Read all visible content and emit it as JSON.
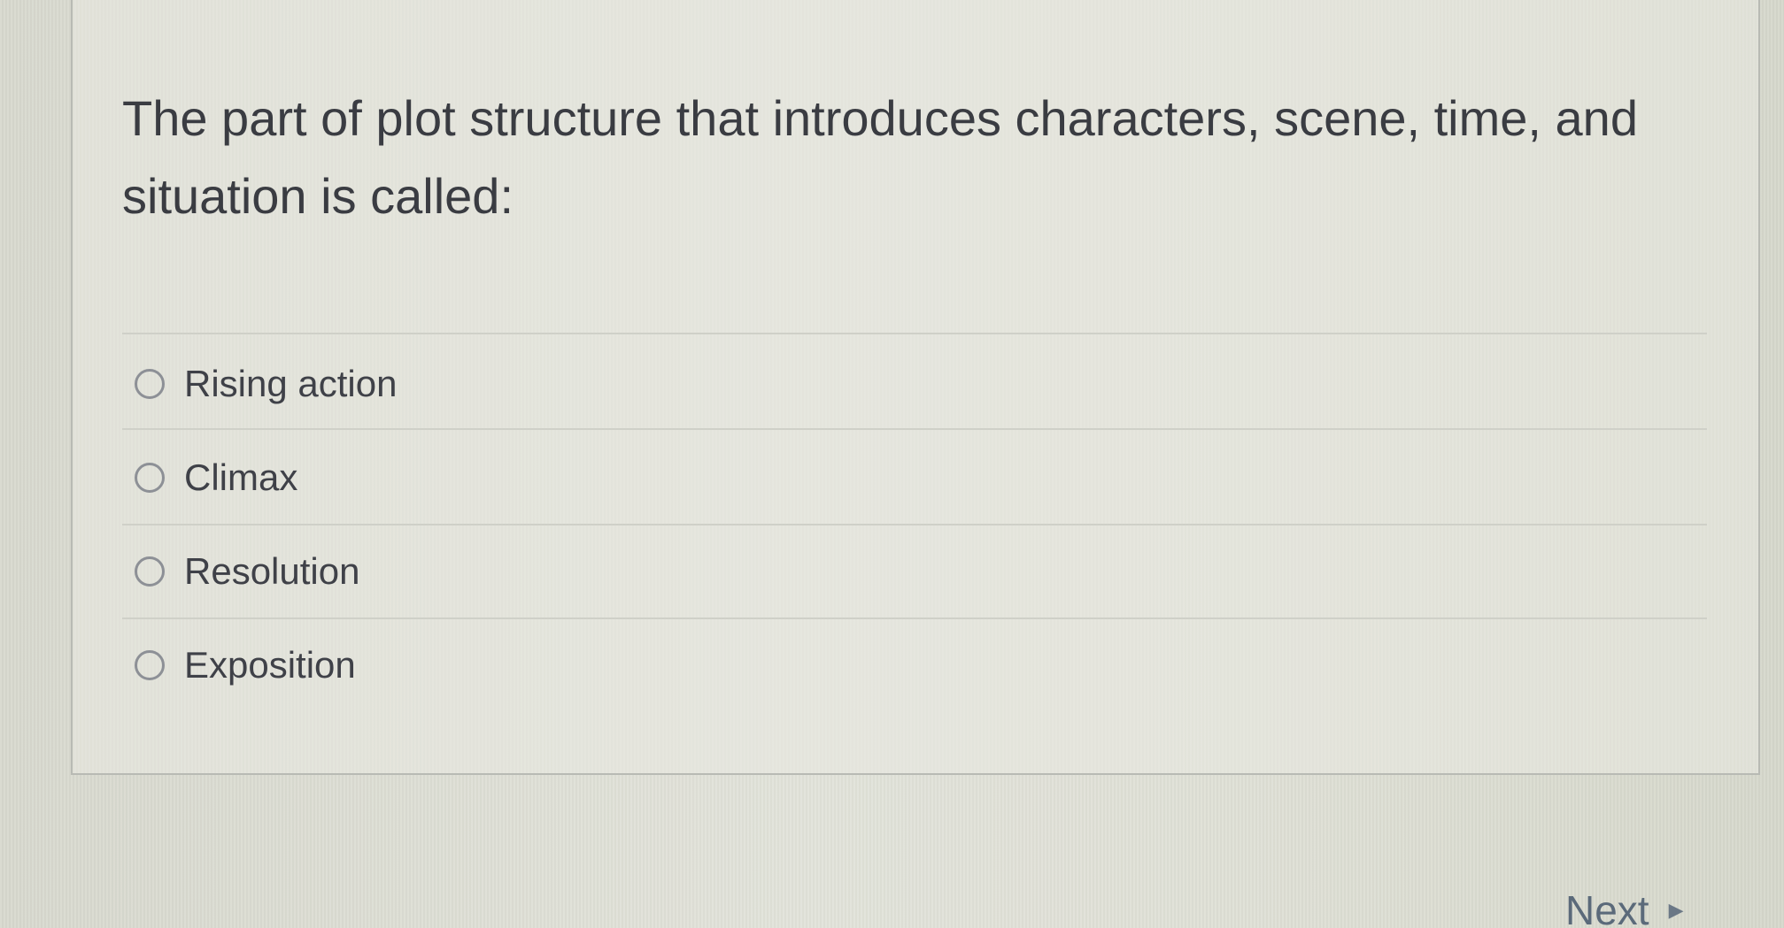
{
  "question": {
    "text": "The part of plot structure that introduces characters, scene, time, and situation is called:"
  },
  "options": [
    {
      "label": "Rising action"
    },
    {
      "label": "Climax"
    },
    {
      "label": "Resolution"
    },
    {
      "label": "Exposition"
    }
  ],
  "navigation": {
    "next_label": "Next",
    "next_icon": "triangle-right-icon"
  }
}
